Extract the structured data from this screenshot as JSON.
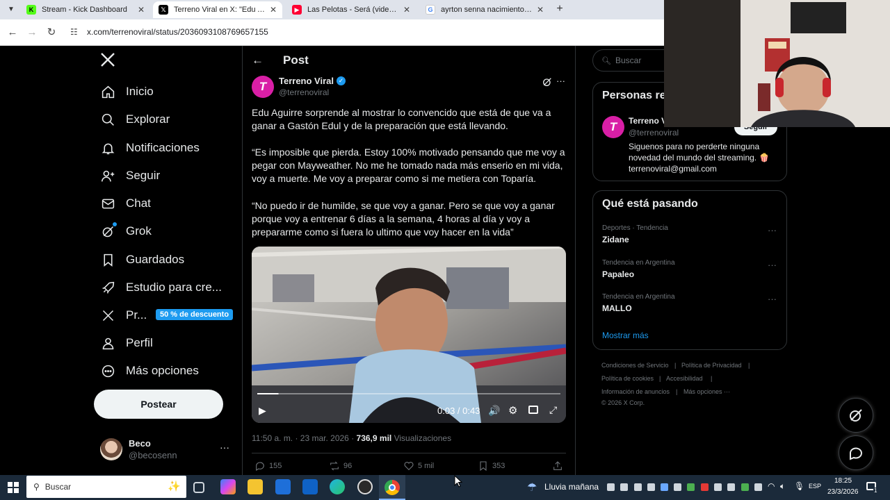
{
  "browser": {
    "tabs": [
      {
        "label": "Stream - Kick Dashboard",
        "favicon": "kick-icon",
        "color": "#53fc18",
        "active": false
      },
      {
        "label": "Terreno Viral en X: \"Edu Aguirre",
        "favicon": "x-icon",
        "color": "#000000",
        "active": true
      },
      {
        "label": "Las Pelotas - Será (video oficial)",
        "favicon": "youtube-icon",
        "color": "#ff0033",
        "active": false
      },
      {
        "label": "ayrton senna nacimiento - Busc",
        "favicon": "google-icon",
        "color": "#4285f4",
        "active": false
      }
    ],
    "url": "x.com/terrenoviral/status/2036093108769657155"
  },
  "nav": {
    "items": [
      {
        "label": "Inicio",
        "icon": "home-icon"
      },
      {
        "label": "Explorar",
        "icon": "search-icon"
      },
      {
        "label": "Notificaciones",
        "icon": "bell-icon"
      },
      {
        "label": "Seguir",
        "icon": "follow-icon"
      },
      {
        "label": "Chat",
        "icon": "mail-icon"
      },
      {
        "label": "Grok",
        "icon": "grok-icon"
      },
      {
        "label": "Guardados",
        "icon": "bookmark-icon"
      },
      {
        "label": "Estudio para cre...",
        "icon": "rocket-icon"
      },
      {
        "label": "Pr...",
        "icon": "x-premium-icon"
      },
      {
        "label": "Perfil",
        "icon": "person-icon"
      },
      {
        "label": "Más opciones",
        "icon": "more-circle-icon"
      }
    ],
    "promo_badge": "50 % de descuento",
    "post_button": "Postear",
    "account": {
      "name": "Beco",
      "handle": "@becosenn"
    }
  },
  "post": {
    "header": "Post",
    "author": {
      "name": "Terreno Viral",
      "handle": "@terrenoviral",
      "verified": true
    },
    "paragraphs": [
      "Edu Aguirre sorprende al mostrar lo convencido que está de que va a ganar a Gastón Edul y de la preparación que está llevando.",
      "“Es imposible que pierda. Estoy 100% motivado pensando que me voy a pegar con Mayweather. No me he tomado nada más enserio en mi vida, voy a muerte. Me voy a preparar como si me metiera con Toparía.",
      "“No puedo ir de humilde, se que voy a ganar. Pero se que voy a ganar porque voy a entrenar 6 días a la semana, 4 horas al día y voy a prepararme como si fuera lo ultimo que voy hacer en la vida”"
    ],
    "video": {
      "time": "0:03 / 0:43",
      "progress": 0.07
    },
    "meta_time": "11:50 a. m. · 23 mar. 2026 ·",
    "views_count": "736,9 mil",
    "views_label": "Visualizaciones",
    "actions": {
      "replies": "155",
      "reposts": "96",
      "likes": "5 mil",
      "bookmarks": "353"
    }
  },
  "right": {
    "search_placeholder": "Buscar",
    "people_title": "Personas re",
    "person": {
      "name": "Terreno V",
      "handle": "@terrenoviral",
      "follow_label": "Seguir",
      "bio": "Siguenos para no perderte ninguna novedad del mundo del streaming. 🍿 terrenoviral@gmail.com"
    },
    "trends_title": "Qué está pasando",
    "trends": [
      {
        "category": "Deportes · Tendencia",
        "name": "Zidane"
      },
      {
        "category": "Tendencia en Argentina",
        "name": "Papaleo"
      },
      {
        "category": "Tendencia en Argentina",
        "name": "MALLO"
      }
    ],
    "show_more": "Mostrar más",
    "footer": [
      "Condiciones de Servicio",
      "Política de Privacidad",
      "Política de cookies",
      "Accesibilidad",
      "Información de anuncios",
      "Más opciones ···",
      "© 2026 X Corp."
    ]
  },
  "taskbar": {
    "search_placeholder": "Buscar",
    "weather": "Lluvia mañana",
    "language": "ESP",
    "time": "18:25",
    "date": "23/3/2026",
    "notification_count": "1"
  },
  "colors": {
    "accent": "#1d9bf0",
    "background": "#000000",
    "text": "#e7e9ea",
    "muted": "#71767b",
    "brand_magenta": "#d91fa6"
  }
}
